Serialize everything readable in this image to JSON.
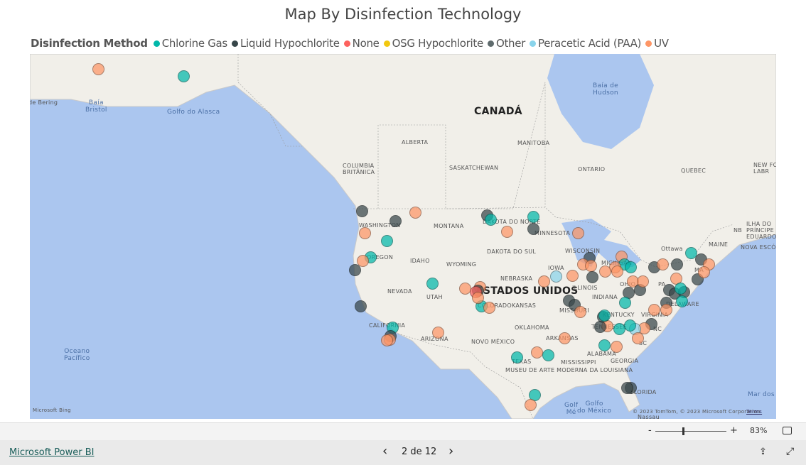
{
  "title": "Map By Disinfection Technology",
  "legend": {
    "title": "Disinfection Method",
    "items": [
      {
        "label": "Chlorine Gas",
        "color": "#01B8AA"
      },
      {
        "label": "Liquid Hypochlorite",
        "color": "#374649"
      },
      {
        "label": "None",
        "color": "#FD625E"
      },
      {
        "label": "OSG Hypochlorite",
        "color": "#F2C80F"
      },
      {
        "label": "Other",
        "color": "#5F6B6D"
      },
      {
        "label": "Peracetic Acid (PAA)",
        "color": "#8AD4EB"
      },
      {
        "label": "UV",
        "color": "#FE9666"
      }
    ]
  },
  "map": {
    "labels": {
      "canada": "CANADÁ",
      "usa": "ESTADOS UNIDOS",
      "bering": "de Bering",
      "bristol": "Baía\nBristol",
      "alaska_gulf": "Golfo do Alasca",
      "hudson": "Baía de\nHudson",
      "alberta": "ALBERTA",
      "manitoba": "MANITOBA",
      "columbia": "COLUMBIA\nBRITÂNICA",
      "saskatchewan": "SASKATCHEWAN",
      "ontario": "ONTARIO",
      "quebec": "QUEBEC",
      "newf": "NEW FO\nLABR",
      "washington": "WASHINGTON",
      "montana": "MONTANA",
      "north_dakota": "DAKOTA DO NORTE",
      "minnesota": "MINNESOTA",
      "oregon": "OREGON",
      "idaho": "IDAHO",
      "south_dakota": "DAKOTA DO SUL",
      "wisconsin": "WISCONSIN",
      "michigan": "MICHIGAN",
      "wyoming": "WYOMING",
      "iowa": "IOWA",
      "nebraska": "NEBRASKA",
      "nevada": "NEVADA",
      "utah": "UTAH",
      "colorado": "COLORADO",
      "illinois": "ILLINOIS",
      "indiana": "INDIANA",
      "ohio": "OHIO",
      "pa": "PA",
      "kansas": "KANSAS",
      "missouri": "MISSOURI",
      "kentucky": "KENTUCKY",
      "virginia": "VIRGINIA",
      "california": "CALIFORNIA",
      "tennessee": "TENNESSEE",
      "nc": "NC",
      "oklahoma": "OKLAHOMA",
      "arizona": "ARIZONA",
      "new_mexico": "NOVO MÉXICO",
      "arkansas": "ARKANSAS",
      "sc": "SC",
      "alabama": "ALABAMA",
      "georgia": "GEORGIA",
      "mississippi": "MISSISSIPPI",
      "texas": "TEXAS",
      "louisiana": "MUSEU DE ARTE MODERNA DA LOUISIANA",
      "florida": "FLORIDA",
      "maine": "MAINE",
      "ottawa": "Ottawa",
      "nb": "NB",
      "pei": "ILHA DO\nPRÍNCIPE\nEDUARDO",
      "ns": "NOVA ESCÓCIA",
      "ma": "MA",
      "delaware": "DELAWARE",
      "pacific": "Oceano\nPacífico",
      "gulf_mexico": "Golfo\ndo México",
      "golf": "Golf\nMé",
      "nassau": "Nassau",
      "sea": "Mar dos",
      "bing": "Microsoft Bing",
      "copyright": "© 2023 TomTom, © 2023 Microsoft Corporation",
      "terms": "Terms"
    }
  },
  "zoom": {
    "minus": "-",
    "plus": "+",
    "level": "83%",
    "level_value": 83
  },
  "footer": {
    "brand": "Microsoft Power BI",
    "page": "2 de 12",
    "prev": "‹",
    "next": "›"
  }
}
